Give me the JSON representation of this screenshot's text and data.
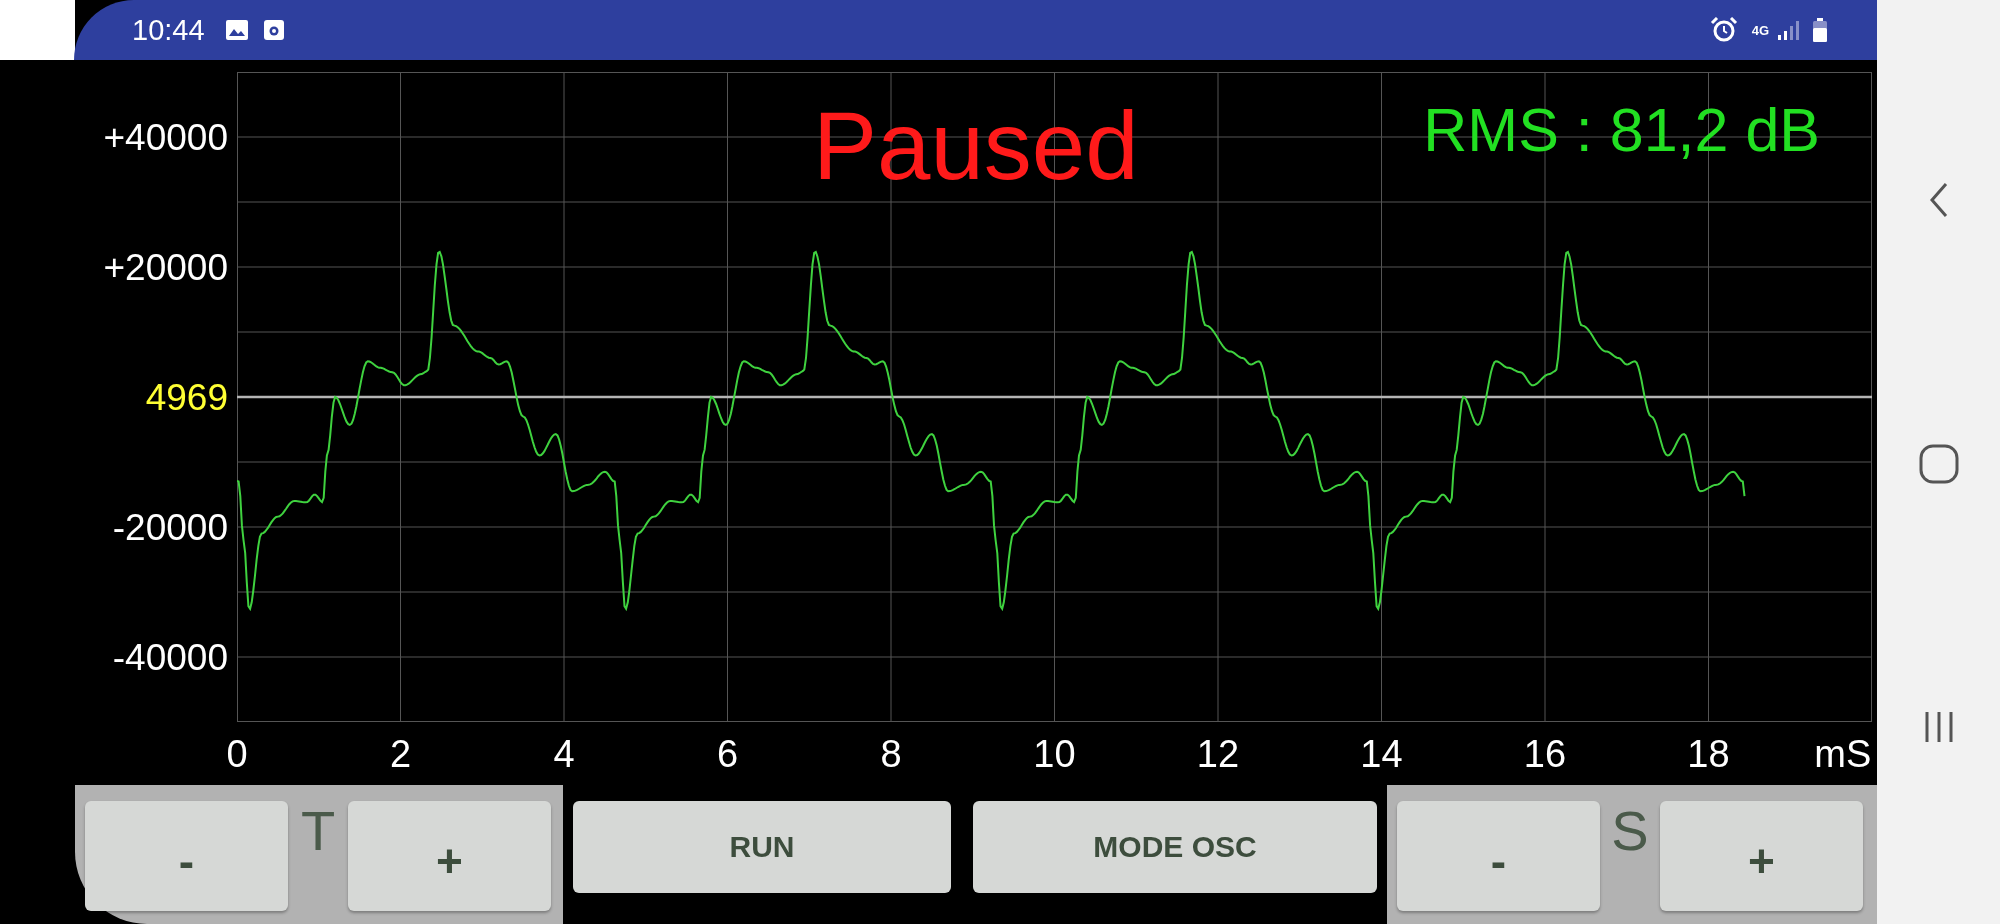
{
  "status_bar": {
    "time": "10:44",
    "network": "4G"
  },
  "scope": {
    "status": "Paused",
    "rms": "RMS : 81,2 dB",
    "y_labels": [
      {
        "text": "+40000",
        "kind": "scale"
      },
      {
        "text": "+20000",
        "kind": "scale"
      },
      {
        "text": "4969",
        "kind": "trigger"
      },
      {
        "text": "-20000",
        "kind": "scale"
      },
      {
        "text": "-40000",
        "kind": "scale"
      }
    ],
    "x_labels": [
      "0",
      "2",
      "4",
      "6",
      "8",
      "10",
      "12",
      "14",
      "16",
      "18"
    ],
    "x_unit": "mS"
  },
  "controls": [
    {
      "kind": "stepper",
      "label": "T",
      "minus": "-",
      "plus": "+"
    },
    {
      "kind": "button",
      "label": "RUN"
    },
    {
      "kind": "button",
      "label": "MODE OSC"
    },
    {
      "kind": "stepper",
      "label": "S",
      "minus": "-",
      "plus": "+"
    }
  ]
}
